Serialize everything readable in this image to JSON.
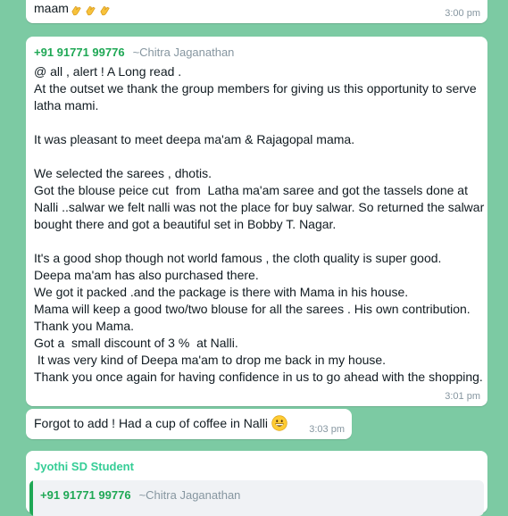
{
  "messages": [
    {
      "text": "maam",
      "emoji": "clapping-hands x3",
      "time": "3:00 pm"
    },
    {
      "sender_phone": "+91 91771 99776",
      "sender_name": "~Chitra Jaganathan",
      "text": "@ all , alert ! A Long read .\nAt the outset we thank the group members for giving us this opportunity to serve latha mami.\n\nIt was pleasant to meet deepa ma'am & Rajagopal mama.\n\nWe selected the sarees , dhotis.\nGot the blouse peice cut  from  Latha ma'am saree and got the tassels done at Nalli ..salwar we felt nalli was not the place for buy salwar. So returned the salwar bought there and got a beautiful set in Bobby T. Nagar.\n\nIt's a good shop though not world famous , the cloth quality is super good.\nDeepa ma'am has also purchased there.\nWe got it packed .and the package is there with Mama in his house.\nMama will keep a good two/two blouse for all the sarees . His own contribution.\nThank you Mama.\nGot a  small discount of 3 %  at Nalli.\n It was very kind of Deepa ma'am to drop me back in my house.\nThank you once again for having confidence in us to go ahead with the shopping.",
      "time": "3:01 pm"
    },
    {
      "text": "Forgot to add ! Had a cup of coffee in Nalli",
      "emoji": "grinning-face",
      "time": "3:03 pm"
    },
    {
      "sender_name": "Jyothi SD Student",
      "quoted_phone": "+91 91771 99776",
      "quoted_name": "~Chitra Jaganathan"
    }
  ],
  "colors": {
    "chat_background": "#7ccaa3",
    "bubble": "#ffffff",
    "phone_green": "#1fa855",
    "sender_green": "#35cd96",
    "meta_gray": "#8696a0"
  }
}
